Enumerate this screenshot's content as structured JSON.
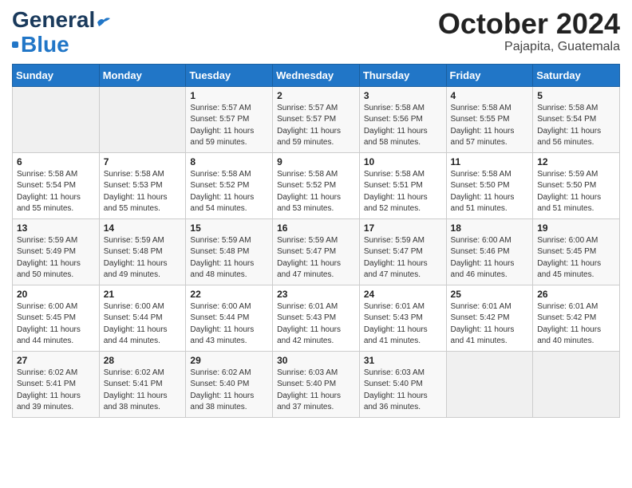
{
  "header": {
    "logo": {
      "name_part1": "General",
      "name_part2": "Blue",
      "tagline": "Blue"
    },
    "title": "October 2024",
    "subtitle": "Pajapita, Guatemala"
  },
  "calendar": {
    "weekdays": [
      "Sunday",
      "Monday",
      "Tuesday",
      "Wednesday",
      "Thursday",
      "Friday",
      "Saturday"
    ],
    "weeks": [
      [
        {
          "day": "",
          "info": ""
        },
        {
          "day": "",
          "info": ""
        },
        {
          "day": "1",
          "info": "Sunrise: 5:57 AM\nSunset: 5:57 PM\nDaylight: 11 hours\nand 59 minutes."
        },
        {
          "day": "2",
          "info": "Sunrise: 5:57 AM\nSunset: 5:57 PM\nDaylight: 11 hours\nand 59 minutes."
        },
        {
          "day": "3",
          "info": "Sunrise: 5:58 AM\nSunset: 5:56 PM\nDaylight: 11 hours\nand 58 minutes."
        },
        {
          "day": "4",
          "info": "Sunrise: 5:58 AM\nSunset: 5:55 PM\nDaylight: 11 hours\nand 57 minutes."
        },
        {
          "day": "5",
          "info": "Sunrise: 5:58 AM\nSunset: 5:54 PM\nDaylight: 11 hours\nand 56 minutes."
        }
      ],
      [
        {
          "day": "6",
          "info": "Sunrise: 5:58 AM\nSunset: 5:54 PM\nDaylight: 11 hours\nand 55 minutes."
        },
        {
          "day": "7",
          "info": "Sunrise: 5:58 AM\nSunset: 5:53 PM\nDaylight: 11 hours\nand 55 minutes."
        },
        {
          "day": "8",
          "info": "Sunrise: 5:58 AM\nSunset: 5:52 PM\nDaylight: 11 hours\nand 54 minutes."
        },
        {
          "day": "9",
          "info": "Sunrise: 5:58 AM\nSunset: 5:52 PM\nDaylight: 11 hours\nand 53 minutes."
        },
        {
          "day": "10",
          "info": "Sunrise: 5:58 AM\nSunset: 5:51 PM\nDaylight: 11 hours\nand 52 minutes."
        },
        {
          "day": "11",
          "info": "Sunrise: 5:58 AM\nSunset: 5:50 PM\nDaylight: 11 hours\nand 51 minutes."
        },
        {
          "day": "12",
          "info": "Sunrise: 5:59 AM\nSunset: 5:50 PM\nDaylight: 11 hours\nand 51 minutes."
        }
      ],
      [
        {
          "day": "13",
          "info": "Sunrise: 5:59 AM\nSunset: 5:49 PM\nDaylight: 11 hours\nand 50 minutes."
        },
        {
          "day": "14",
          "info": "Sunrise: 5:59 AM\nSunset: 5:48 PM\nDaylight: 11 hours\nand 49 minutes."
        },
        {
          "day": "15",
          "info": "Sunrise: 5:59 AM\nSunset: 5:48 PM\nDaylight: 11 hours\nand 48 minutes."
        },
        {
          "day": "16",
          "info": "Sunrise: 5:59 AM\nSunset: 5:47 PM\nDaylight: 11 hours\nand 47 minutes."
        },
        {
          "day": "17",
          "info": "Sunrise: 5:59 AM\nSunset: 5:47 PM\nDaylight: 11 hours\nand 47 minutes."
        },
        {
          "day": "18",
          "info": "Sunrise: 6:00 AM\nSunset: 5:46 PM\nDaylight: 11 hours\nand 46 minutes."
        },
        {
          "day": "19",
          "info": "Sunrise: 6:00 AM\nSunset: 5:45 PM\nDaylight: 11 hours\nand 45 minutes."
        }
      ],
      [
        {
          "day": "20",
          "info": "Sunrise: 6:00 AM\nSunset: 5:45 PM\nDaylight: 11 hours\nand 44 minutes."
        },
        {
          "day": "21",
          "info": "Sunrise: 6:00 AM\nSunset: 5:44 PM\nDaylight: 11 hours\nand 44 minutes."
        },
        {
          "day": "22",
          "info": "Sunrise: 6:00 AM\nSunset: 5:44 PM\nDaylight: 11 hours\nand 43 minutes."
        },
        {
          "day": "23",
          "info": "Sunrise: 6:01 AM\nSunset: 5:43 PM\nDaylight: 11 hours\nand 42 minutes."
        },
        {
          "day": "24",
          "info": "Sunrise: 6:01 AM\nSunset: 5:43 PM\nDaylight: 11 hours\nand 41 minutes."
        },
        {
          "day": "25",
          "info": "Sunrise: 6:01 AM\nSunset: 5:42 PM\nDaylight: 11 hours\nand 41 minutes."
        },
        {
          "day": "26",
          "info": "Sunrise: 6:01 AM\nSunset: 5:42 PM\nDaylight: 11 hours\nand 40 minutes."
        }
      ],
      [
        {
          "day": "27",
          "info": "Sunrise: 6:02 AM\nSunset: 5:41 PM\nDaylight: 11 hours\nand 39 minutes."
        },
        {
          "day": "28",
          "info": "Sunrise: 6:02 AM\nSunset: 5:41 PM\nDaylight: 11 hours\nand 38 minutes."
        },
        {
          "day": "29",
          "info": "Sunrise: 6:02 AM\nSunset: 5:40 PM\nDaylight: 11 hours\nand 38 minutes."
        },
        {
          "day": "30",
          "info": "Sunrise: 6:03 AM\nSunset: 5:40 PM\nDaylight: 11 hours\nand 37 minutes."
        },
        {
          "day": "31",
          "info": "Sunrise: 6:03 AM\nSunset: 5:40 PM\nDaylight: 11 hours\nand 36 minutes."
        },
        {
          "day": "",
          "info": ""
        },
        {
          "day": "",
          "info": ""
        }
      ]
    ]
  }
}
